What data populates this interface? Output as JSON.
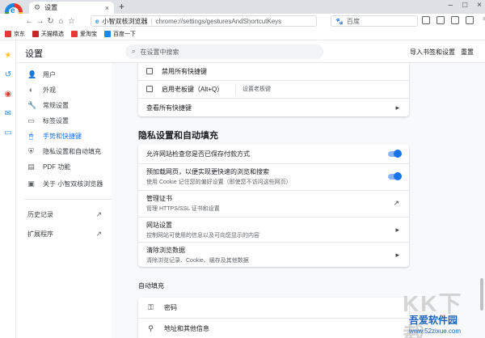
{
  "tab": {
    "title": "设置"
  },
  "addressbar": {
    "app_name": "小智双核浏览器",
    "url": "chrome://settings/gesturesAndShortcutKeys"
  },
  "search_engine": {
    "label": "百度"
  },
  "bookmarks": [
    {
      "label": "京东",
      "color": "#e53935"
    },
    {
      "label": "天猫精选",
      "color": "#c62828"
    },
    {
      "label": "爱淘宝",
      "color": "#e53935"
    },
    {
      "label": "百度一下",
      "color": "#1e88e5"
    }
  ],
  "settings": {
    "title": "设置",
    "search_placeholder": "在设置中搜索",
    "import_label": "导入书签和设置",
    "reset_label": "重置"
  },
  "sidebar": {
    "items": [
      {
        "label": "用户",
        "icon": "user-icon"
      },
      {
        "label": "外观",
        "icon": "palette-icon"
      },
      {
        "label": "常规设置",
        "icon": "wrench-icon"
      },
      {
        "label": "标签设置",
        "icon": "tab-icon"
      },
      {
        "label": "手势和快捷键",
        "icon": "mouse-icon",
        "active": true
      },
      {
        "label": "隐私设置和自动填充",
        "icon": "shield-icon"
      },
      {
        "label": "PDF 功能",
        "icon": "pdf-icon"
      },
      {
        "label": "关于 小智双核浏览器",
        "icon": "info-icon"
      }
    ],
    "history_label": "历史记录",
    "extensions_label": "扩展程序"
  },
  "shortcuts_card": {
    "disable_all_label": "禁用所有快捷键",
    "boss_key_label": "启用老板键（Alt+Q）",
    "boss_key_button": "设置老板键",
    "view_all_label": "查看所有快捷键"
  },
  "privacy": {
    "section_title": "隐私设置和自动填充",
    "rows": [
      {
        "title": "允许网站检查您是否已保存付款方式",
        "type": "toggle",
        "on": true
      },
      {
        "title": "预加载网页，以便实现更快速的浏览和搜索",
        "subtitle": "使用 Cookie 记住您的偏好设置（即使您不访问这些网页）",
        "type": "toggle",
        "on": true
      },
      {
        "title": "管理证书",
        "subtitle": "管理 HTTPS/SSL 证书和设置",
        "type": "external"
      },
      {
        "title": "网站设置",
        "subtitle": "控制网站可使用的信息以及可向您显示的内容",
        "type": "arrow"
      },
      {
        "title": "清除浏览数据",
        "subtitle": "清除浏览记录、Cookie、缓存及其他数据",
        "type": "arrow"
      }
    ]
  },
  "autofill": {
    "section_title": "自动填充",
    "rows": [
      {
        "label": "密码",
        "icon": "key-icon"
      },
      {
        "label": "地址和其他信息",
        "icon": "location-pin-icon"
      }
    ]
  },
  "watermark": {
    "text": "吾爱软件园",
    "url": "www.52zixue.com",
    "big": "KK下载"
  },
  "colors": {
    "accent": "#1a73e8",
    "toggle_track": "#8ab4f8"
  }
}
